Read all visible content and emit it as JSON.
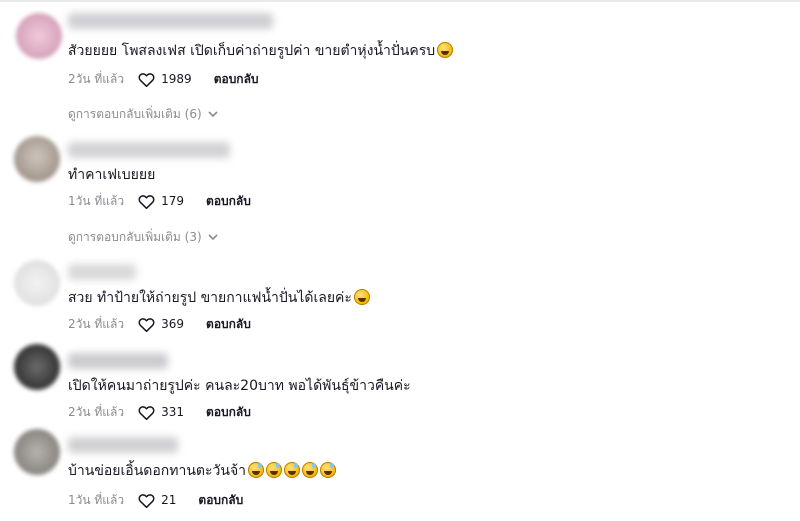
{
  "comments": [
    {
      "text": "สัวยยยย โพสลงเฟส เปิดเก็บค่าถ่ายรูปค่า ขายตำหุ่งน้ำปั่นครบ",
      "emojis": [
        "rolling-laughing-emoji"
      ],
      "time": "2วัน ที่แล้ว",
      "likes": "1989",
      "reply_label": "ตอบกลับ",
      "more_replies": "ดูการตอบกลับเพิ่มเติม (6)"
    },
    {
      "text": "ทำคาเฟเบยยย",
      "emojis": [],
      "time": "1วัน ที่แล้ว",
      "likes": "179",
      "reply_label": "ตอบกลับ",
      "more_replies": "ดูการตอบกลับเพิ่มเติม (3)"
    },
    {
      "text": "สวย ทำป้ายให้ถ่ายรูป ขายกาแฟน้ำปั่นได้เลยค่ะ",
      "emojis": [
        "grinning-emoji"
      ],
      "time": "2วัน ที่แล้ว",
      "likes": "369",
      "reply_label": "ตอบกลับ"
    },
    {
      "text": "เปิดให้คนมาถ่ายรูปค่ะ คนละ20บาท พอได้พันธุ์ข้าวคืนค่ะ",
      "emojis": [],
      "time": "2วัน ที่แล้ว",
      "likes": "331",
      "reply_label": "ตอบกลับ"
    },
    {
      "text": "บ้านข่อยเอิ้นดอกทานตะวันจ้า",
      "emojis": [
        "grinning-sweat-emoji",
        "grinning-sweat-emoji",
        "grinning-sweat-emoji",
        "grinning-sweat-emoji",
        "grinning-sweat-emoji"
      ],
      "time": "1วัน ที่แล้ว",
      "likes": "21",
      "reply_label": "ตอบกลับ"
    }
  ],
  "colors": {
    "text": "#161823",
    "muted": "#8a8b91",
    "background": "#ffffff"
  }
}
